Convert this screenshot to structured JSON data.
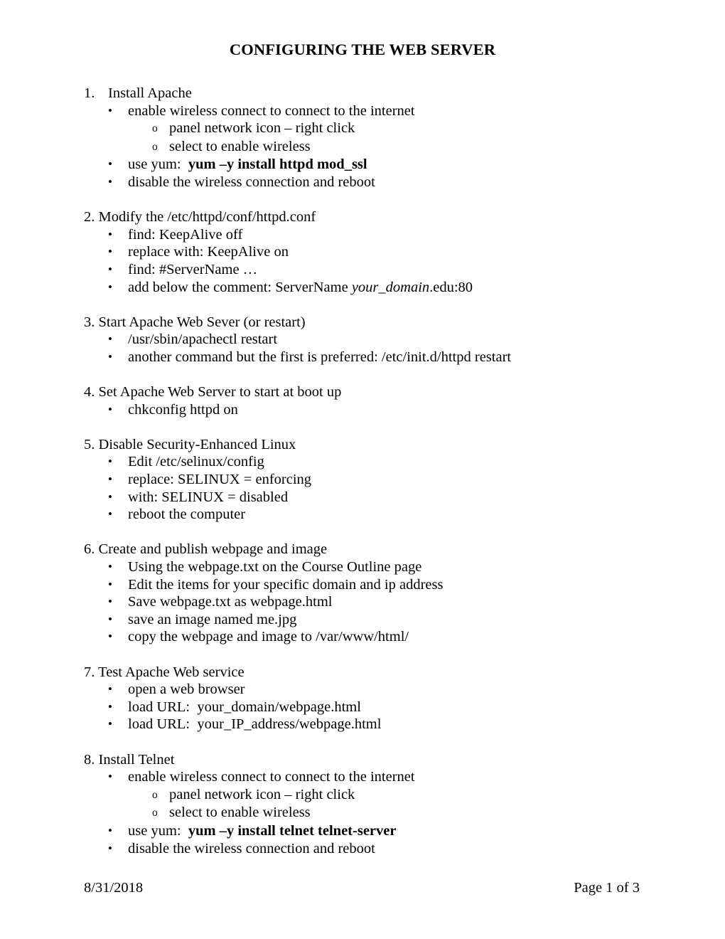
{
  "document": {
    "title": "CONFIGURING THE WEB SERVER"
  },
  "markers": {
    "bullet": "•",
    "circle": "o"
  },
  "sections": [
    {
      "number": "1.",
      "heading": "Install Apache",
      "style": "tabbed",
      "items": [
        {
          "level": 1,
          "text": "enable wireless connect to connect to the internet"
        },
        {
          "level": 2,
          "text": "panel network icon – right click"
        },
        {
          "level": 2,
          "text": "select to enable wireless"
        },
        {
          "level": 1,
          "text": "use yum:  ",
          "bold_text": "yum –y install httpd mod_ssl"
        },
        {
          "level": 1,
          "text": "disable the wireless connection and reboot"
        }
      ]
    },
    {
      "number": "2.",
      "heading": "Modify the /etc/httpd/conf/httpd.conf",
      "style": "plain",
      "items": [
        {
          "level": 1,
          "text": "find: KeepAlive off"
        },
        {
          "level": 1,
          "text": "replace with: KeepAlive on"
        },
        {
          "level": 1,
          "text": "find: #ServerName …"
        },
        {
          "level": 1,
          "text": "add below the comment: ServerName ",
          "italic_text": "your_domain",
          "tail_text": ".edu:80"
        }
      ]
    },
    {
      "number": "3.",
      "heading": "Start Apache Web Sever (or restart)",
      "style": "plain",
      "items": [
        {
          "level": 1,
          "text": "/usr/sbin/apachectl restart"
        },
        {
          "level": 1,
          "text": "another command but the first is preferred: /etc/init.d/httpd restart"
        }
      ]
    },
    {
      "number": "4.",
      "heading": "Set Apache Web Server to start at boot up",
      "style": "plain",
      "items": [
        {
          "level": 1,
          "text": "chkconfig httpd on"
        }
      ]
    },
    {
      "number": "5.",
      "heading": "Disable Security-Enhanced Linux",
      "style": "plain",
      "items": [
        {
          "level": 1,
          "text": "Edit /etc/selinux/config"
        },
        {
          "level": 1,
          "text": "replace: SELINUX = enforcing"
        },
        {
          "level": 1,
          "text": "with: SELINUX = disabled"
        },
        {
          "level": 1,
          "text": "reboot the computer"
        }
      ]
    },
    {
      "number": "6.",
      "heading": "Create and publish webpage and image",
      "style": "plain",
      "items": [
        {
          "level": 1,
          "text": "Using the webpage.txt on the Course Outline page"
        },
        {
          "level": 1,
          "text": "Edit the items for your specific domain and ip address"
        },
        {
          "level": 1,
          "text": "Save webpage.txt as webpage.html"
        },
        {
          "level": 1,
          "text": "save an image named me.jpg"
        },
        {
          "level": 1,
          "text": "copy the webpage and image to /var/www/html/"
        }
      ]
    },
    {
      "number": "7.",
      "heading": "Test Apache Web service",
      "style": "plain",
      "items": [
        {
          "level": 1,
          "text": "open a web browser"
        },
        {
          "level": 1,
          "text": "load URL:  your_domain/webpage.html"
        },
        {
          "level": 1,
          "text": "load URL:  your_IP_address/webpage.html"
        }
      ]
    },
    {
      "number": "8.",
      "heading": "Install Telnet",
      "style": "plain",
      "items": [
        {
          "level": 1,
          "text": "enable wireless connect to connect to the internet"
        },
        {
          "level": 2,
          "text": "panel network icon – right click"
        },
        {
          "level": 2,
          "text": "select to enable wireless"
        },
        {
          "level": 1,
          "text": "use yum:  ",
          "bold_text": "yum –y install telnet telnet-server"
        },
        {
          "level": 1,
          "text": "disable the wireless connection and reboot"
        }
      ]
    }
  ],
  "footer": {
    "date": "8/31/2018",
    "page_label": "Page 1 of 3"
  }
}
